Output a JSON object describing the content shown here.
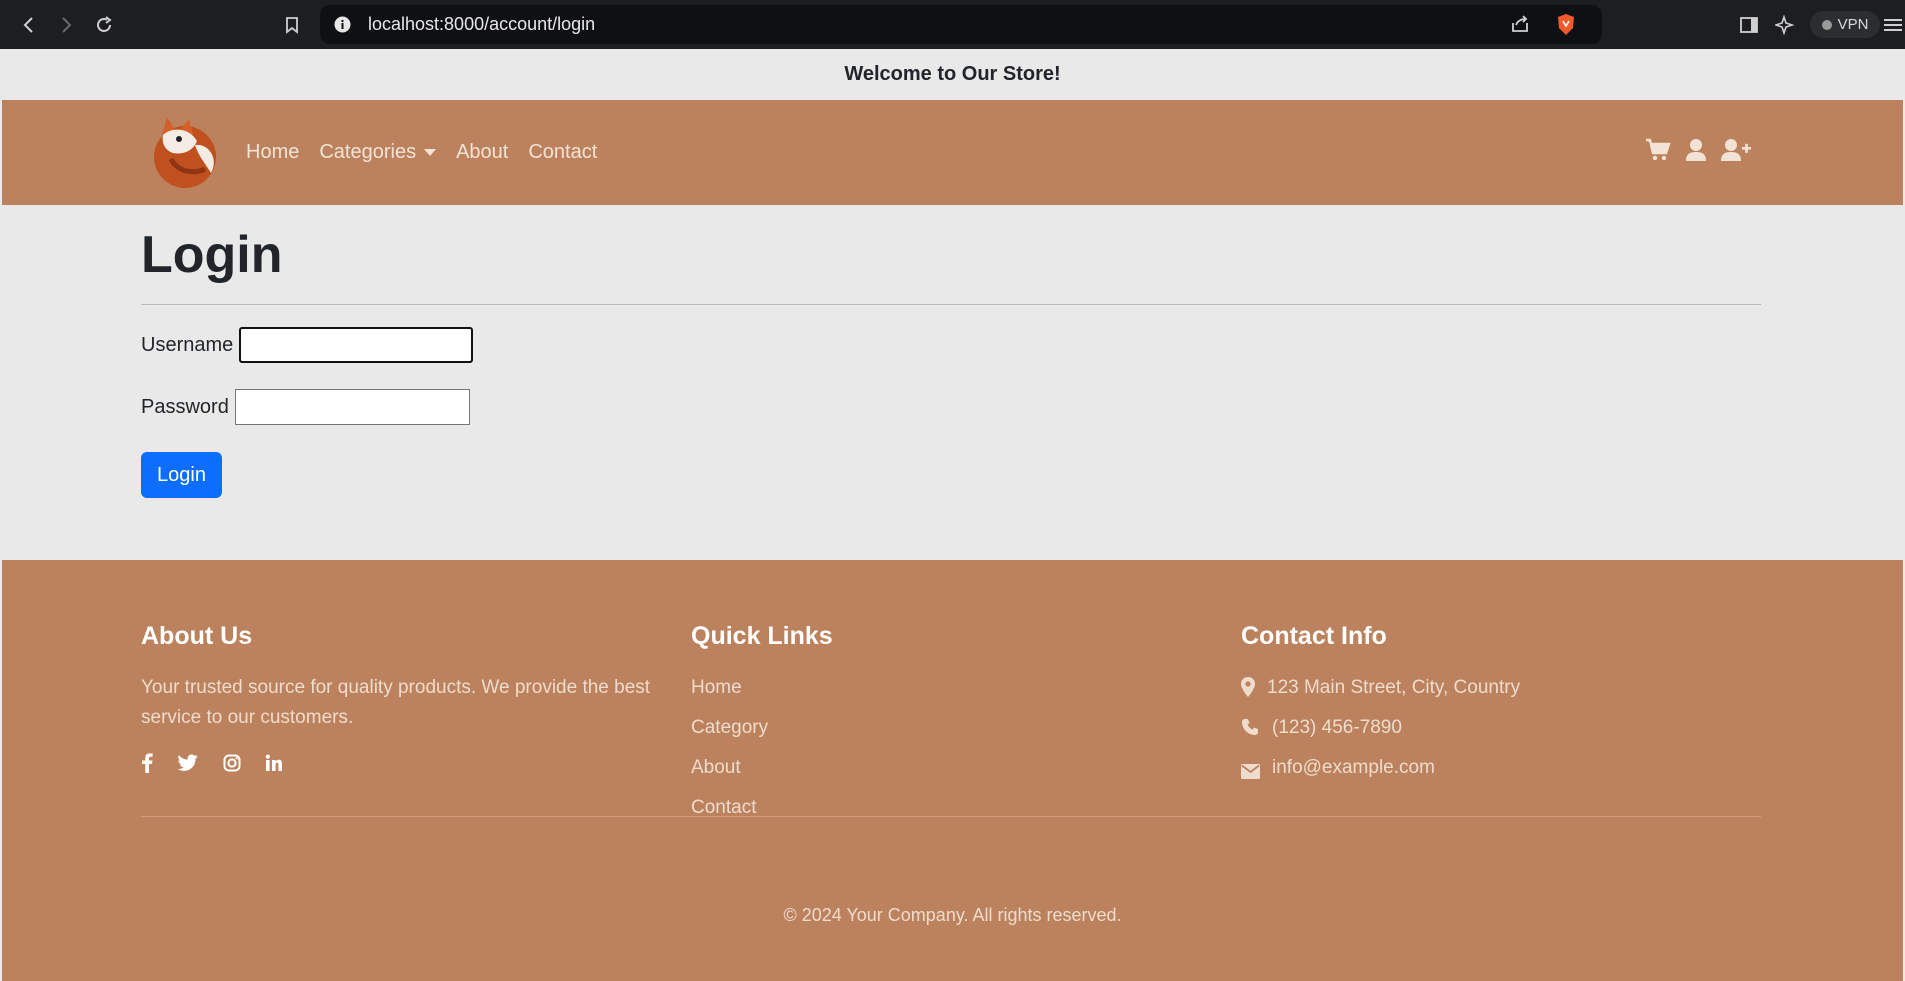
{
  "browser": {
    "url": "localhost:8000/account/login",
    "vpn_label": "VPN"
  },
  "topbar": {
    "message": "Welcome to Our Store!"
  },
  "navbar": {
    "links": [
      {
        "label": "Home"
      },
      {
        "label": "Categories"
      },
      {
        "label": "About"
      },
      {
        "label": "Contact"
      }
    ]
  },
  "login": {
    "title": "Login",
    "username_label": "Username",
    "username_value": "",
    "password_label": "Password",
    "password_value": "",
    "submit_label": "Login",
    "submit_color": "#0d6efd"
  },
  "footer": {
    "about": {
      "heading": "About Us",
      "text": "Your trusted source for quality products. We provide the best service to our customers."
    },
    "quick_links": {
      "heading": "Quick Links",
      "items": [
        "Home",
        "Category",
        "About",
        "Contact"
      ]
    },
    "contact": {
      "heading": "Contact Info",
      "address": "123 Main Street, City, Country",
      "phone": "(123) 456-7890",
      "email": "info@example.com"
    },
    "copyright": "© 2024 Your Company. All rights reserved."
  },
  "colors": {
    "brand": "#bc825d",
    "page_bg": "#e9e9e9",
    "primary": "#0d6efd"
  }
}
